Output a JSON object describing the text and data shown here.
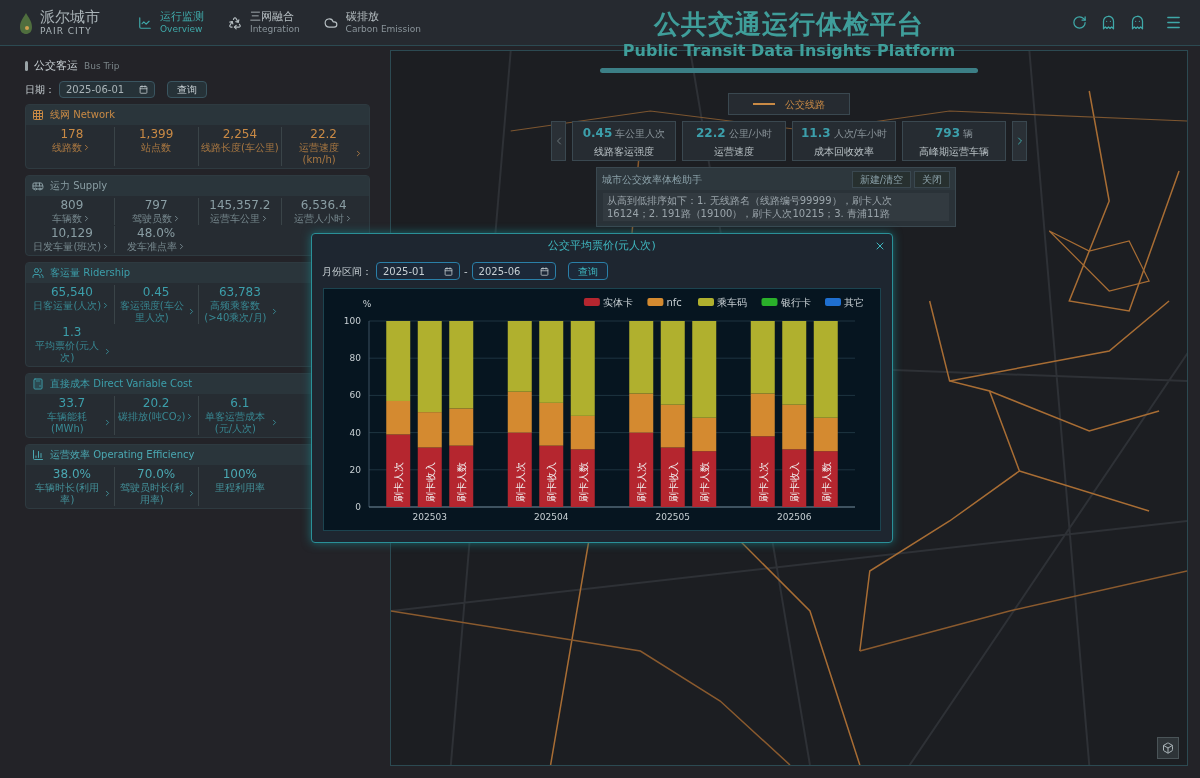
{
  "header": {
    "logo": {
      "name": "派尔城市",
      "sub": "PAIR CITY"
    },
    "nav": [
      {
        "label": "运行监测",
        "sub": "Overview",
        "selected": true
      },
      {
        "label": "三网融合",
        "sub": "Integration",
        "selected": false
      },
      {
        "label": "碳排放",
        "sub": "Carbon Emission",
        "selected": false
      }
    ],
    "title": "公共交通运行体检平台",
    "subtitle": "Public Transit Data Insights Platform"
  },
  "left": {
    "section": {
      "title": "公交客运",
      "sub": "Bus Trip"
    },
    "date_label": "日期：",
    "date_value": "2025-06-01",
    "query": "查询",
    "cards": [
      {
        "title": "线网 Network",
        "color": "#c98a45",
        "rows": [
          [
            {
              "value": "178",
              "label": "线路数",
              "link": true
            },
            {
              "value": "1,399",
              "label": "站点数",
              "link": false
            },
            {
              "value": "2,254",
              "label": "线路长度(车公里)",
              "link": false
            },
            {
              "value": "22.2",
              "label": "运营速度(km/h)",
              "link": true
            }
          ]
        ]
      },
      {
        "title": "运力 Supply",
        "color": "#8a9ea4",
        "rows": [
          [
            {
              "value": "809",
              "label": "车辆数",
              "link": true
            },
            {
              "value": "797",
              "label": "驾驶员数",
              "link": true
            },
            {
              "value": "145,357.2",
              "label": "运营车公里",
              "link": true
            },
            {
              "value": "6,536.4",
              "label": "运营人小时",
              "link": true
            }
          ],
          [
            {
              "value": "10,129",
              "label": "日发车量(班次)",
              "link": true
            },
            {
              "value": "48.0%",
              "label": "发车准点率",
              "link": true
            }
          ]
        ]
      },
      {
        "title": "客运量 Ridership",
        "color": "#3c9fab",
        "rows": [
          [
            {
              "value": "65,540",
              "label": "日客运量(人次)",
              "link": true
            },
            {
              "value": "0.45",
              "label": "客运强度(车公里人次)",
              "link": true
            },
            {
              "value": "63,783",
              "label": "高频乘客数(>40乘次/月)",
              "link": true
            }
          ],
          [
            {
              "value": "1.3",
              "label": "平均票价(元人次)",
              "link": true
            }
          ]
        ]
      },
      {
        "title": "直接成本 Direct Variable Cost",
        "color": "#3c9fab",
        "rows": [
          [
            {
              "value": "33.7",
              "label": "车辆能耗(MWh)",
              "link": true
            },
            {
              "value": "20.2",
              "label": "碳排放(吨CO$_{2}$)",
              "link": true
            },
            {
              "value": "6.1",
              "label": "单客运营成本(元/人次)",
              "link": true
            }
          ]
        ]
      },
      {
        "title": "运营效率 Operating Efficiency",
        "color": "#4aa8b2",
        "rows": [
          [
            {
              "value": "38.0%",
              "label": "车辆时长(利用率)",
              "link": true
            },
            {
              "value": "70.0%",
              "label": "驾驶员时长(利用率)",
              "link": true
            },
            {
              "value": "100%",
              "label": "里程利用率",
              "link": false
            }
          ]
        ]
      }
    ]
  },
  "map": {
    "legend": "公交线路",
    "pager": {
      "prev_disabled": true,
      "next_disabled": false
    },
    "kpis": [
      {
        "value": "0.45",
        "unit": "车公里人次",
        "label": "线路客运强度"
      },
      {
        "value": "22.2",
        "unit": "公里/小时",
        "label": "运营速度"
      },
      {
        "value": "11.3",
        "unit": "人次/车小时",
        "label": "成本回收效率"
      },
      {
        "value": "793",
        "unit": "辆",
        "label": "高峰期运营车辆"
      }
    ],
    "assistant": {
      "title": "城市公交效率体检助手",
      "buttons": [
        "新建/清空",
        "关闭"
      ],
      "lines": [
        "从高到低排序如下：1. 无线路名（线路编号99999），刷卡人次",
        "16124；2. 191路（19100），刷卡人次10215；3. 青浦11路"
      ]
    }
  },
  "modal": {
    "title": "公交平均票价(元人次)",
    "range_label": "月份区间：",
    "from": "2025-01",
    "separator": "-",
    "to": "2025-06",
    "query": "查询",
    "chart_data": {
      "type": "bar",
      "stacked": true,
      "ylabel": "%",
      "ylim": [
        0,
        100
      ],
      "yticks": [
        0,
        20,
        40,
        60,
        80,
        100
      ],
      "categories": [
        null,
        "202503",
        null,
        null,
        "202504",
        null,
        null,
        "202505",
        null,
        null,
        "202506",
        null
      ],
      "annotations": [
        "刷卡人次",
        "刷卡收入",
        "刷卡人数",
        "刷卡人次",
        "刷卡收入",
        "刷卡人数",
        "刷卡人次",
        "刷卡收入",
        "刷卡人数",
        "刷卡人次",
        "刷卡收入",
        "刷卡人数"
      ],
      "grid": true,
      "legend": "top-right",
      "series": [
        {
          "name": "实体卡",
          "color": "#b5262f",
          "values": [
            39,
            32,
            33,
            40,
            33,
            31,
            40,
            32,
            30,
            38,
            31,
            30
          ]
        },
        {
          "name": "nfc",
          "color": "#d48a30",
          "values": [
            18,
            19,
            20,
            22,
            23,
            18,
            21,
            23,
            18,
            23,
            24,
            18
          ]
        },
        {
          "name": "乘车码",
          "color": "#b0b02e",
          "values": [
            43,
            49,
            47,
            38,
            44,
            51,
            39,
            45,
            52,
            39,
            45,
            52
          ]
        },
        {
          "name": "银行卡",
          "color": "#2ab02a",
          "values": [
            0,
            0,
            0,
            0,
            0,
            0,
            0,
            0,
            0,
            0,
            0,
            0
          ]
        },
        {
          "name": "其它",
          "color": "#1f6fd0",
          "values": [
            0,
            0,
            0,
            0,
            0,
            0,
            0,
            0,
            0,
            0,
            0,
            0
          ]
        }
      ]
    }
  }
}
